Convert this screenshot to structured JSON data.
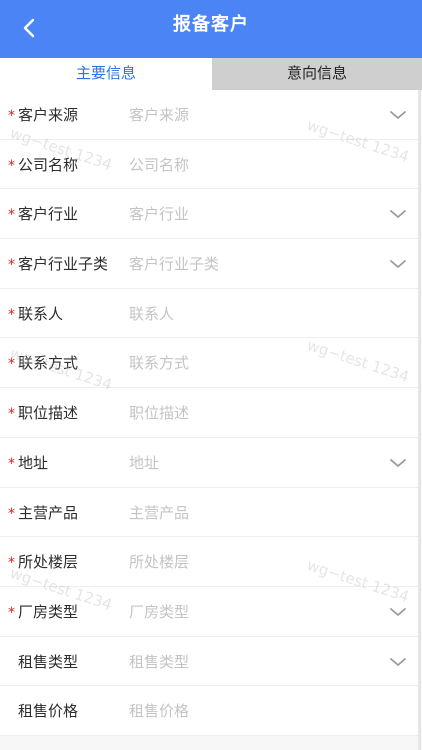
{
  "header": {
    "title": "报备客户"
  },
  "tabs": [
    {
      "label": "主要信息"
    },
    {
      "label": "意向信息"
    }
  ],
  "watermark": "wg−test 1234",
  "fields": [
    {
      "label": "客户来源",
      "placeholder": "客户来源",
      "required": true,
      "dropdown": true
    },
    {
      "label": "公司名称",
      "placeholder": "公司名称",
      "required": true,
      "dropdown": false
    },
    {
      "label": "客户行业",
      "placeholder": "客户行业",
      "required": true,
      "dropdown": true
    },
    {
      "label": "客户行业子类",
      "placeholder": "客户行业子类",
      "required": true,
      "dropdown": true
    },
    {
      "label": "联系人",
      "placeholder": "联系人",
      "required": true,
      "dropdown": false
    },
    {
      "label": "联系方式",
      "placeholder": "联系方式",
      "required": true,
      "dropdown": false
    },
    {
      "label": "职位描述",
      "placeholder": "职位描述",
      "required": true,
      "dropdown": false
    },
    {
      "label": "地址",
      "placeholder": "地址",
      "required": true,
      "dropdown": true
    },
    {
      "label": "主营产品",
      "placeholder": "主营产品",
      "required": true,
      "dropdown": false
    },
    {
      "label": "所处楼层",
      "placeholder": "所处楼层",
      "required": true,
      "dropdown": false
    },
    {
      "label": "厂房类型",
      "placeholder": "厂房类型",
      "required": true,
      "dropdown": true
    },
    {
      "label": "租售类型",
      "placeholder": "租售类型",
      "required": false,
      "dropdown": true
    },
    {
      "label": "租售价格",
      "placeholder": "租售价格",
      "required": false,
      "dropdown": false
    }
  ],
  "required_mark": "*",
  "colors": {
    "header": "#4a84f5",
    "active_tab_text": "#2f6fe0",
    "inactive_tab_bg": "#cfcfcf",
    "required": "#e02020"
  }
}
